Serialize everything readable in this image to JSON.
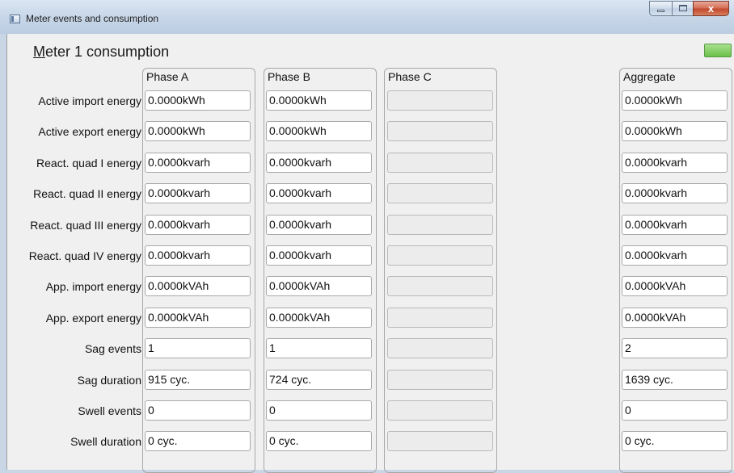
{
  "window": {
    "title": "Meter events and consumption",
    "close_glyph": "x"
  },
  "section": {
    "title_prefix": "M",
    "title_rest": "eter 1 consumption",
    "status_color": "#6cc14a"
  },
  "columns": [
    "Phase A",
    "Phase B",
    "Phase C",
    "Aggregate"
  ],
  "rows": [
    {
      "label": "Active import energy",
      "a": "0.0000kWh",
      "b": "0.0000kWh",
      "c": "",
      "agg": "0.0000kWh"
    },
    {
      "label": "Active export energy",
      "a": "0.0000kWh",
      "b": "0.0000kWh",
      "c": "",
      "agg": "0.0000kWh"
    },
    {
      "label": "React. quad I energy",
      "a": "0.0000kvarh",
      "b": "0.0000kvarh",
      "c": "",
      "agg": "0.0000kvarh"
    },
    {
      "label": "React. quad II energy",
      "a": "0.0000kvarh",
      "b": "0.0000kvarh",
      "c": "",
      "agg": "0.0000kvarh"
    },
    {
      "label": "React. quad III energy",
      "a": "0.0000kvarh",
      "b": "0.0000kvarh",
      "c": "",
      "agg": "0.0000kvarh"
    },
    {
      "label": "React. quad IV energy",
      "a": "0.0000kvarh",
      "b": "0.0000kvarh",
      "c": "",
      "agg": "0.0000kvarh"
    },
    {
      "label": "App. import energy",
      "a": "0.0000kVAh",
      "b": "0.0000kVAh",
      "c": "",
      "agg": "0.0000kVAh"
    },
    {
      "label": "App. export energy",
      "a": "0.0000kVAh",
      "b": "0.0000kVAh",
      "c": "",
      "agg": "0.0000kVAh"
    },
    {
      "label": "Sag events",
      "a": "1",
      "b": "1",
      "c": "",
      "agg": "2"
    },
    {
      "label": "Sag duration",
      "a": "915 cyc.",
      "b": "724 cyc.",
      "c": "",
      "agg": "1639 cyc."
    },
    {
      "label": "Swell events",
      "a": "0",
      "b": "0",
      "c": "",
      "agg": "0"
    },
    {
      "label": "Swell duration",
      "a": "0 cyc.",
      "b": "0 cyc.",
      "c": "",
      "agg": "0 cyc."
    }
  ]
}
